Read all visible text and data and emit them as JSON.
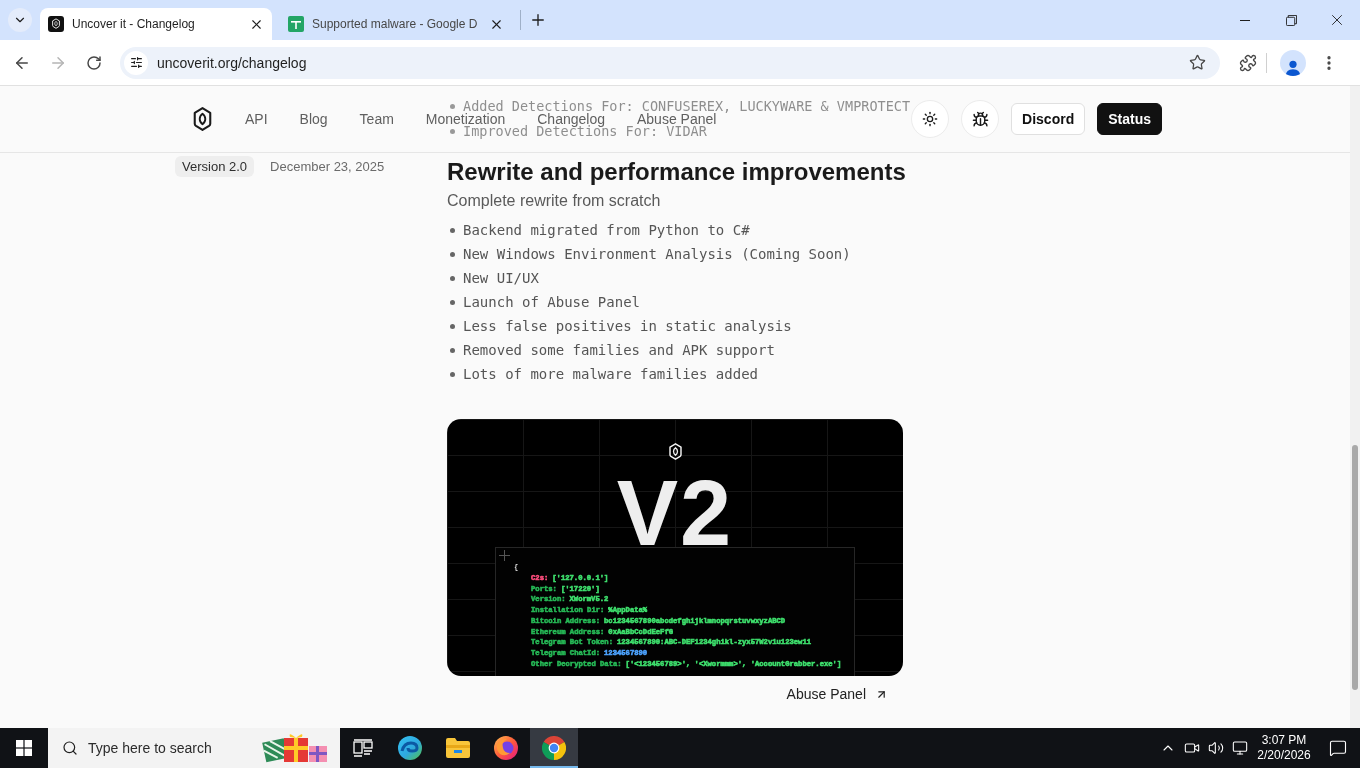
{
  "browser": {
    "tabs": [
      {
        "kind": "logo",
        "title": "Uncover it - Changelog",
        "selected": true
      },
      {
        "kind": "sheet",
        "title": "Supported malware - Google D",
        "selected": false
      }
    ],
    "forward_disabled": true,
    "address": "uncoverit.org/changelog"
  },
  "header": {
    "nav": [
      "API",
      "Blog",
      "Team",
      "Monetization",
      "Changelog",
      "Abuse Panel"
    ],
    "buttons": [
      {
        "kind": "outline",
        "label": "Discord"
      },
      {
        "kind": "solid",
        "label": "Status"
      }
    ]
  },
  "previous_items": [
    "Added Detections For: CONFUSEREX, LUCKYWARE & VMPROTECT",
    "Improved Detections For: VIDAR"
  ],
  "entry": {
    "version": "Version 2.0",
    "date": "December 23, 2025",
    "title": "Rewrite and performance improvements",
    "subtitle": "Complete rewrite from scratch",
    "items": [
      "Backend migrated from Python to C#",
      "New Windows Environment Analysis (Coming Soon)",
      "New UI/UX",
      "Launch of Abuse Panel",
      "Less false positives in static analysis",
      "Removed some families and APK support",
      "Lots of more malware families added"
    ],
    "image": {
      "heading": "V2",
      "brace": "{",
      "lines": [
        {
          "key": {
            "text": "C2s:",
            "color": "#ff4d7d"
          },
          "value": {
            "text": "['127.0.0.1']",
            "color": "#3ee06d"
          }
        },
        {
          "key": {
            "text": "Ports:",
            "color": "#26b956"
          },
          "value": {
            "text": "['17220']",
            "color": "#3ee06d"
          }
        },
        {
          "key": {
            "text": "Version:",
            "color": "#26b956"
          },
          "value": {
            "text": "XWormV5.2",
            "color": "#3ee06d"
          }
        },
        {
          "key": {
            "text": "Installation Dir:",
            "color": "#26b956"
          },
          "value": {
            "text": "%AppData%",
            "color": "#3ee06d"
          }
        },
        {
          "key": {
            "text": "Bitcoin Address:",
            "color": "#26b956"
          },
          "value": {
            "text": "bc1234567890abcdefghijklmnopqrstuvwxyzABCD",
            "color": "#3ee06d"
          }
        },
        {
          "key": {
            "text": "Ethereum Address:",
            "color": "#26b956"
          },
          "value": {
            "text": "0xAaBbCcDdEeFfG",
            "color": "#3ee06d"
          }
        },
        {
          "key": {
            "text": "Telegram Bot Token:",
            "color": "#26b956"
          },
          "value": {
            "text": "1234567890:ABC-DEF1234ghikl-zyx57W2v1u123ew11",
            "color": "#3ee06d"
          }
        },
        {
          "key": {
            "text": "Telegram ChatId:",
            "color": "#26b956"
          },
          "value": {
            "text": "1234567890",
            "color": "#4da3ff"
          }
        },
        {
          "key": {
            "text": "Other Decrypted Data:",
            "color": "#26b956"
          },
          "value": {
            "text": "['<123456789>', '<Xwormmm>', 'AccountGrabber.exe']",
            "color": "#3ee06d"
          }
        }
      ]
    },
    "link": "Abuse Panel"
  },
  "taskbar": {
    "search_placeholder": "Type here to search",
    "apps": [
      {
        "kind": "task-view",
        "selected": false
      },
      {
        "kind": "edge",
        "selected": false
      },
      {
        "kind": "explorer",
        "selected": false
      },
      {
        "kind": "firefox",
        "selected": false
      },
      {
        "kind": "chrome",
        "selected": true
      }
    ],
    "time": "3:07 PM",
    "date": "2/20/2026"
  }
}
